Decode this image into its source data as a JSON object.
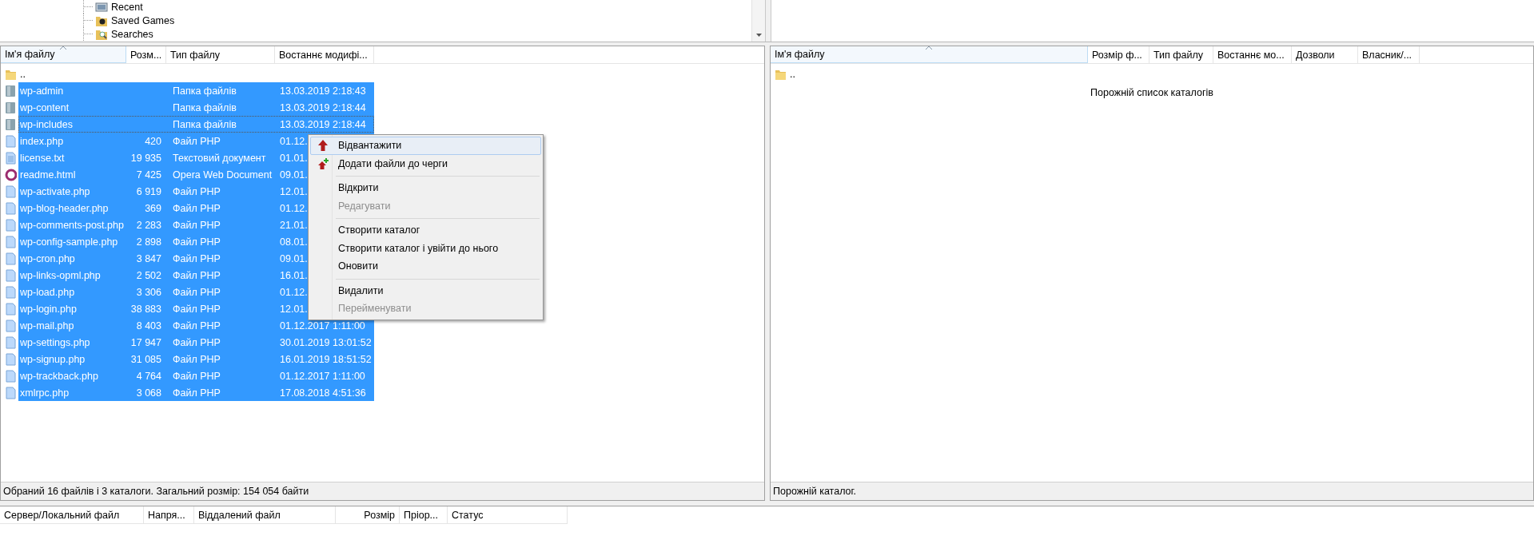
{
  "local_tree": {
    "items": [
      {
        "label": "Recent",
        "kind": "recent"
      },
      {
        "label": "Saved Games",
        "kind": "games"
      },
      {
        "label": "Searches",
        "kind": "search"
      }
    ]
  },
  "local_list": {
    "columns": [
      {
        "label": "Ім'я файлу",
        "sorted": true
      },
      {
        "label": "Розм...",
        "sorted": false
      },
      {
        "label": "Тип файлу",
        "sorted": false
      },
      {
        "label": "Востаннє модифі...",
        "sorted": false
      }
    ],
    "rows": [
      {
        "kind": "parent",
        "name": "..",
        "size": "",
        "type": "",
        "modified": "",
        "selected": false,
        "focused": false
      },
      {
        "kind": "folder",
        "name": "wp-admin",
        "size": "",
        "type": "Папка файлів",
        "modified": "13.03.2019 2:18:43",
        "selected": true,
        "focused": false
      },
      {
        "kind": "folder",
        "name": "wp-content",
        "size": "",
        "type": "Папка файлів",
        "modified": "13.03.2019 2:18:44",
        "selected": true,
        "focused": false
      },
      {
        "kind": "folder",
        "name": "wp-includes",
        "size": "",
        "type": "Папка файлів",
        "modified": "13.03.2019 2:18:44",
        "selected": true,
        "focused": true
      },
      {
        "kind": "file",
        "name": "index.php",
        "size": "420",
        "type": "Файл PHP",
        "modified": "01.12.",
        "selected": true,
        "focused": false
      },
      {
        "kind": "text",
        "name": "license.txt",
        "size": "19 935",
        "type": "Текстовий документ",
        "modified": "01.01.",
        "selected": true,
        "focused": false
      },
      {
        "kind": "html",
        "name": "readme.html",
        "size": "7 425",
        "type": "Opera Web Document",
        "modified": "09.01.",
        "selected": true,
        "focused": false
      },
      {
        "kind": "file",
        "name": "wp-activate.php",
        "size": "6 919",
        "type": "Файл PHP",
        "modified": "12.01.",
        "selected": true,
        "focused": false
      },
      {
        "kind": "file",
        "name": "wp-blog-header.php",
        "size": "369",
        "type": "Файл PHP",
        "modified": "01.12.",
        "selected": true,
        "focused": false
      },
      {
        "kind": "file",
        "name": "wp-comments-post.php",
        "size": "2 283",
        "type": "Файл PHP",
        "modified": "21.01.",
        "selected": true,
        "focused": false
      },
      {
        "kind": "file",
        "name": "wp-config-sample.php",
        "size": "2 898",
        "type": "Файл PHP",
        "modified": "08.01.",
        "selected": true,
        "focused": false
      },
      {
        "kind": "file",
        "name": "wp-cron.php",
        "size": "3 847",
        "type": "Файл PHP",
        "modified": "09.01.",
        "selected": true,
        "focused": false
      },
      {
        "kind": "file",
        "name": "wp-links-opml.php",
        "size": "2 502",
        "type": "Файл PHP",
        "modified": "16.01.",
        "selected": true,
        "focused": false
      },
      {
        "kind": "file",
        "name": "wp-load.php",
        "size": "3 306",
        "type": "Файл PHP",
        "modified": "01.12.",
        "selected": true,
        "focused": false
      },
      {
        "kind": "file",
        "name": "wp-login.php",
        "size": "38 883",
        "type": "Файл PHP",
        "modified": "12.01.",
        "selected": true,
        "focused": false
      },
      {
        "kind": "file",
        "name": "wp-mail.php",
        "size": "8 403",
        "type": "Файл PHP",
        "modified": "01.12.2017 1:11:00",
        "selected": true,
        "focused": false
      },
      {
        "kind": "file",
        "name": "wp-settings.php",
        "size": "17 947",
        "type": "Файл PHP",
        "modified": "30.01.2019 13:01:52",
        "selected": true,
        "focused": false
      },
      {
        "kind": "file",
        "name": "wp-signup.php",
        "size": "31 085",
        "type": "Файл PHP",
        "modified": "16.01.2019 18:51:52",
        "selected": true,
        "focused": false
      },
      {
        "kind": "file",
        "name": "wp-trackback.php",
        "size": "4 764",
        "type": "Файл PHP",
        "modified": "01.12.2017 1:11:00",
        "selected": true,
        "focused": false
      },
      {
        "kind": "file",
        "name": "xmlrpc.php",
        "size": "3 068",
        "type": "Файл PHP",
        "modified": "17.08.2018 4:51:36",
        "selected": true,
        "focused": false
      }
    ],
    "status": "Обраний 16 файлів і 3 каталоги. Загальний розмір: 154 054 байти"
  },
  "context_menu": {
    "items": [
      {
        "kind": "item",
        "label": "Відвантажити",
        "selected": true,
        "disabled": false
      },
      {
        "kind": "item",
        "label": "Додати файли до черги",
        "selected": false,
        "disabled": false
      },
      {
        "kind": "separator"
      },
      {
        "kind": "item",
        "label": "Відкрити",
        "selected": false,
        "disabled": false
      },
      {
        "kind": "item",
        "label": "Редагувати",
        "selected": false,
        "disabled": true
      },
      {
        "kind": "separator"
      },
      {
        "kind": "item",
        "label": "Створити каталог",
        "selected": false,
        "disabled": false
      },
      {
        "kind": "item",
        "label": "Створити каталог і увійти до нього",
        "selected": false,
        "disabled": false
      },
      {
        "kind": "item",
        "label": "Оновити",
        "selected": false,
        "disabled": false
      },
      {
        "kind": "separator"
      },
      {
        "kind": "item",
        "label": "Видалити",
        "selected": false,
        "disabled": false
      },
      {
        "kind": "item",
        "label": "Перейменувати",
        "selected": false,
        "disabled": true
      }
    ]
  },
  "remote_list": {
    "columns": [
      {
        "label": "Ім'я файлу",
        "sorted": true
      },
      {
        "label": "Розмір ф...",
        "sorted": false
      },
      {
        "label": "Тип файлу",
        "sorted": false
      },
      {
        "label": "Востаннє мо...",
        "sorted": false
      },
      {
        "label": "Дозволи",
        "sorted": false
      },
      {
        "label": "Власник/...",
        "sorted": false
      }
    ],
    "rows": [
      {
        "kind": "parent",
        "name": ".."
      }
    ],
    "empty_message": "Порожній список каталогів",
    "status": "Порожній каталог."
  },
  "queue": {
    "columns": [
      {
        "label": "Сервер/Локальний файл"
      },
      {
        "label": "Напря..."
      },
      {
        "label": "Віддалений файл"
      },
      {
        "label": "Розмір"
      },
      {
        "label": "Пріор..."
      },
      {
        "label": "Статус"
      }
    ]
  }
}
